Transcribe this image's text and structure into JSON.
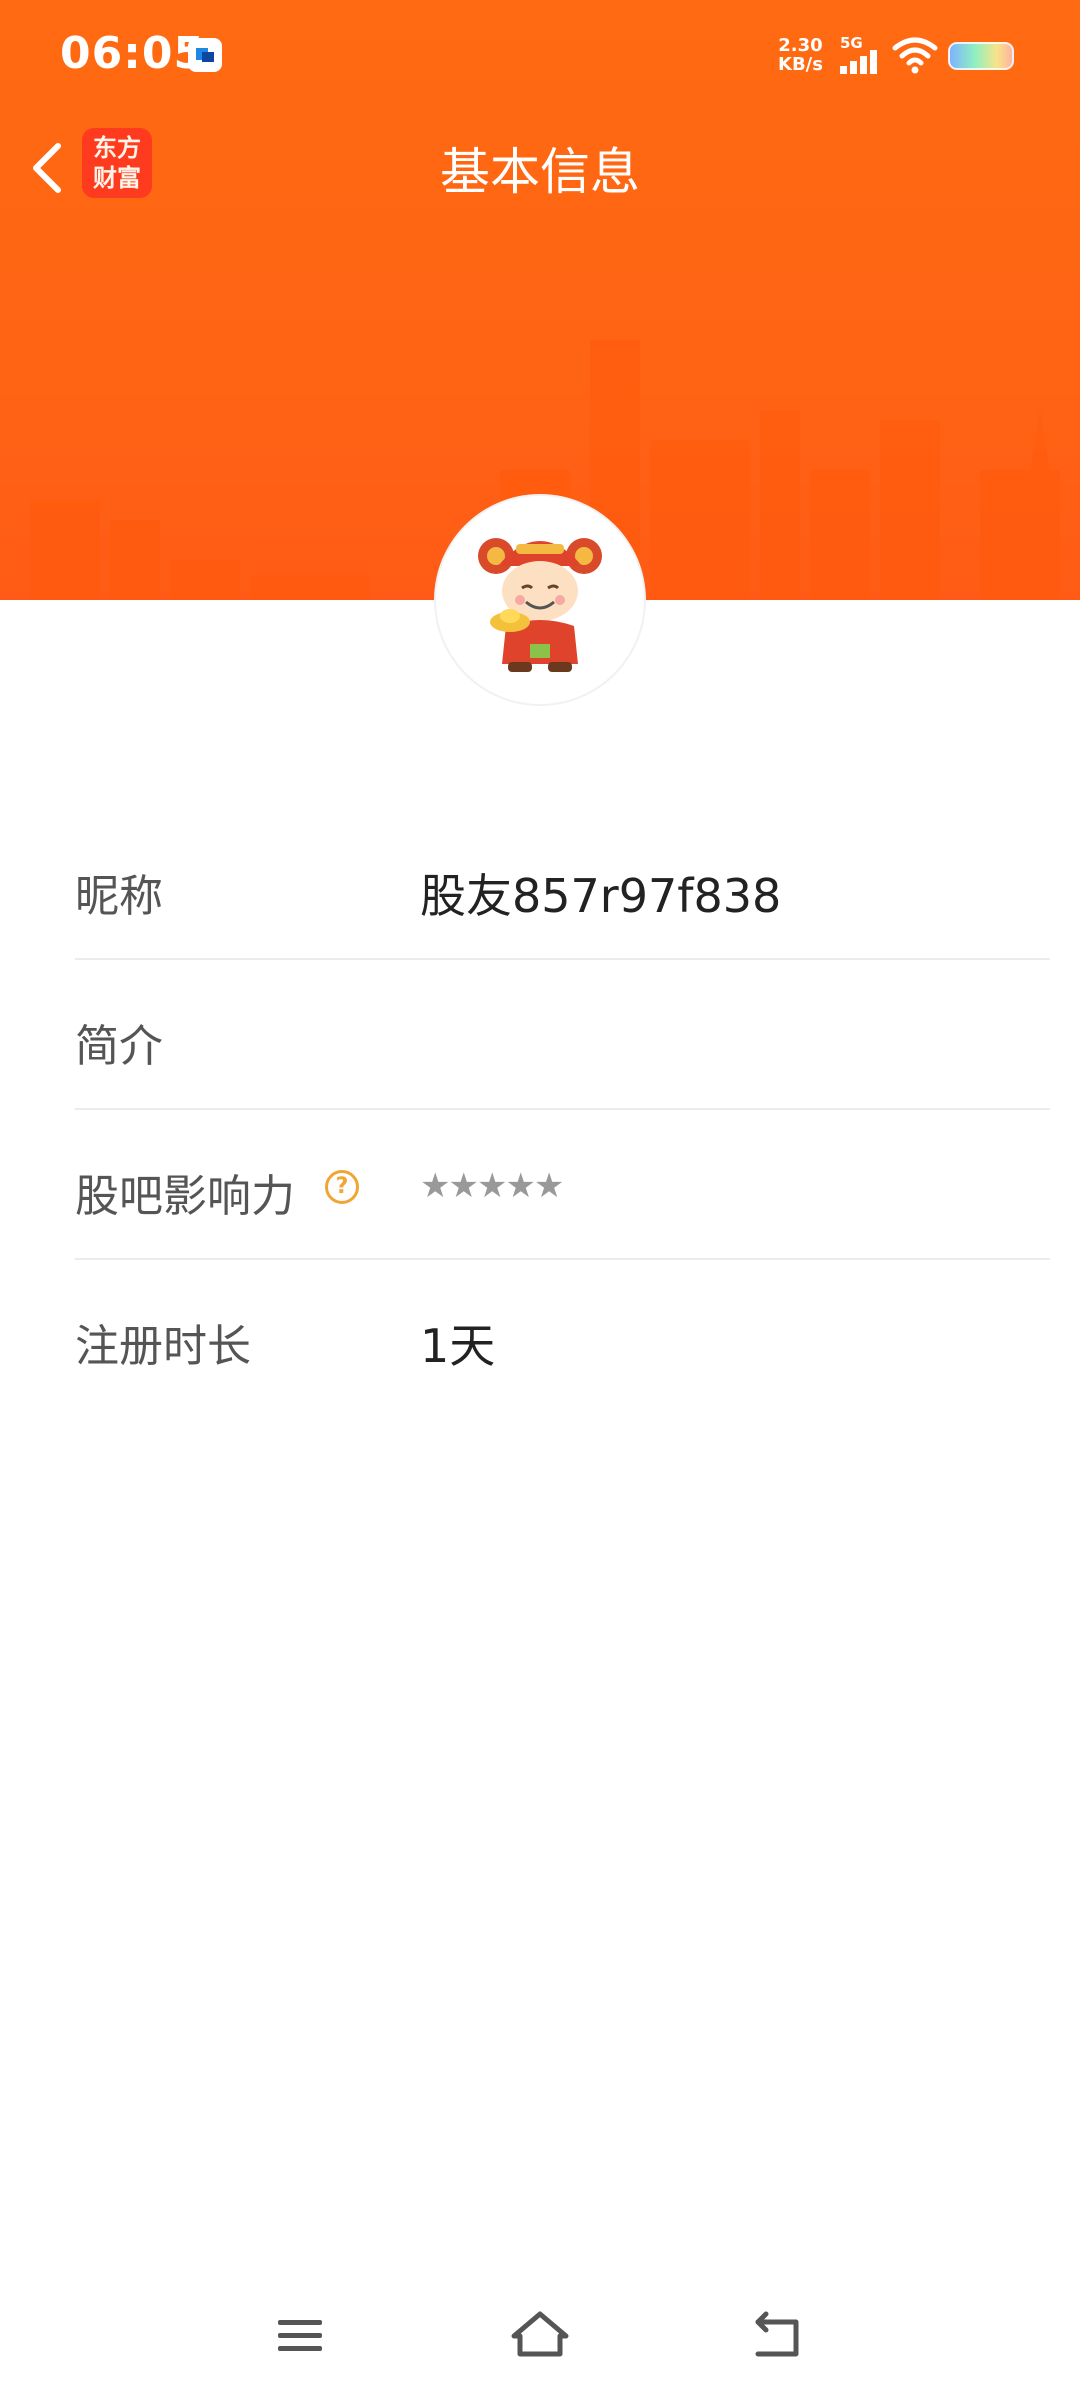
{
  "status_bar": {
    "time": "06:05",
    "net_speed_value": "2.30",
    "net_speed_unit": "KB/s",
    "network_type": "5G"
  },
  "nav": {
    "title": "基本信息",
    "logo_line1": "东方",
    "logo_line2": "财富"
  },
  "profile": {
    "rows": [
      {
        "label": "昵称",
        "value": "股友857r97f838"
      },
      {
        "label": "简介",
        "value": ""
      },
      {
        "label": "股吧影响力",
        "help": "?",
        "stars": "★★★★★"
      },
      {
        "label": "注册时长",
        "value": "1天"
      }
    ]
  },
  "colors": {
    "header_orange": "#ff6414",
    "help_icon": "#f0a534",
    "star_gray": "#999999"
  },
  "icons": {
    "back": "chevron-left-icon",
    "help": "question-circle-icon",
    "menu": "menu-icon",
    "home": "home-icon",
    "return": "return-icon"
  }
}
